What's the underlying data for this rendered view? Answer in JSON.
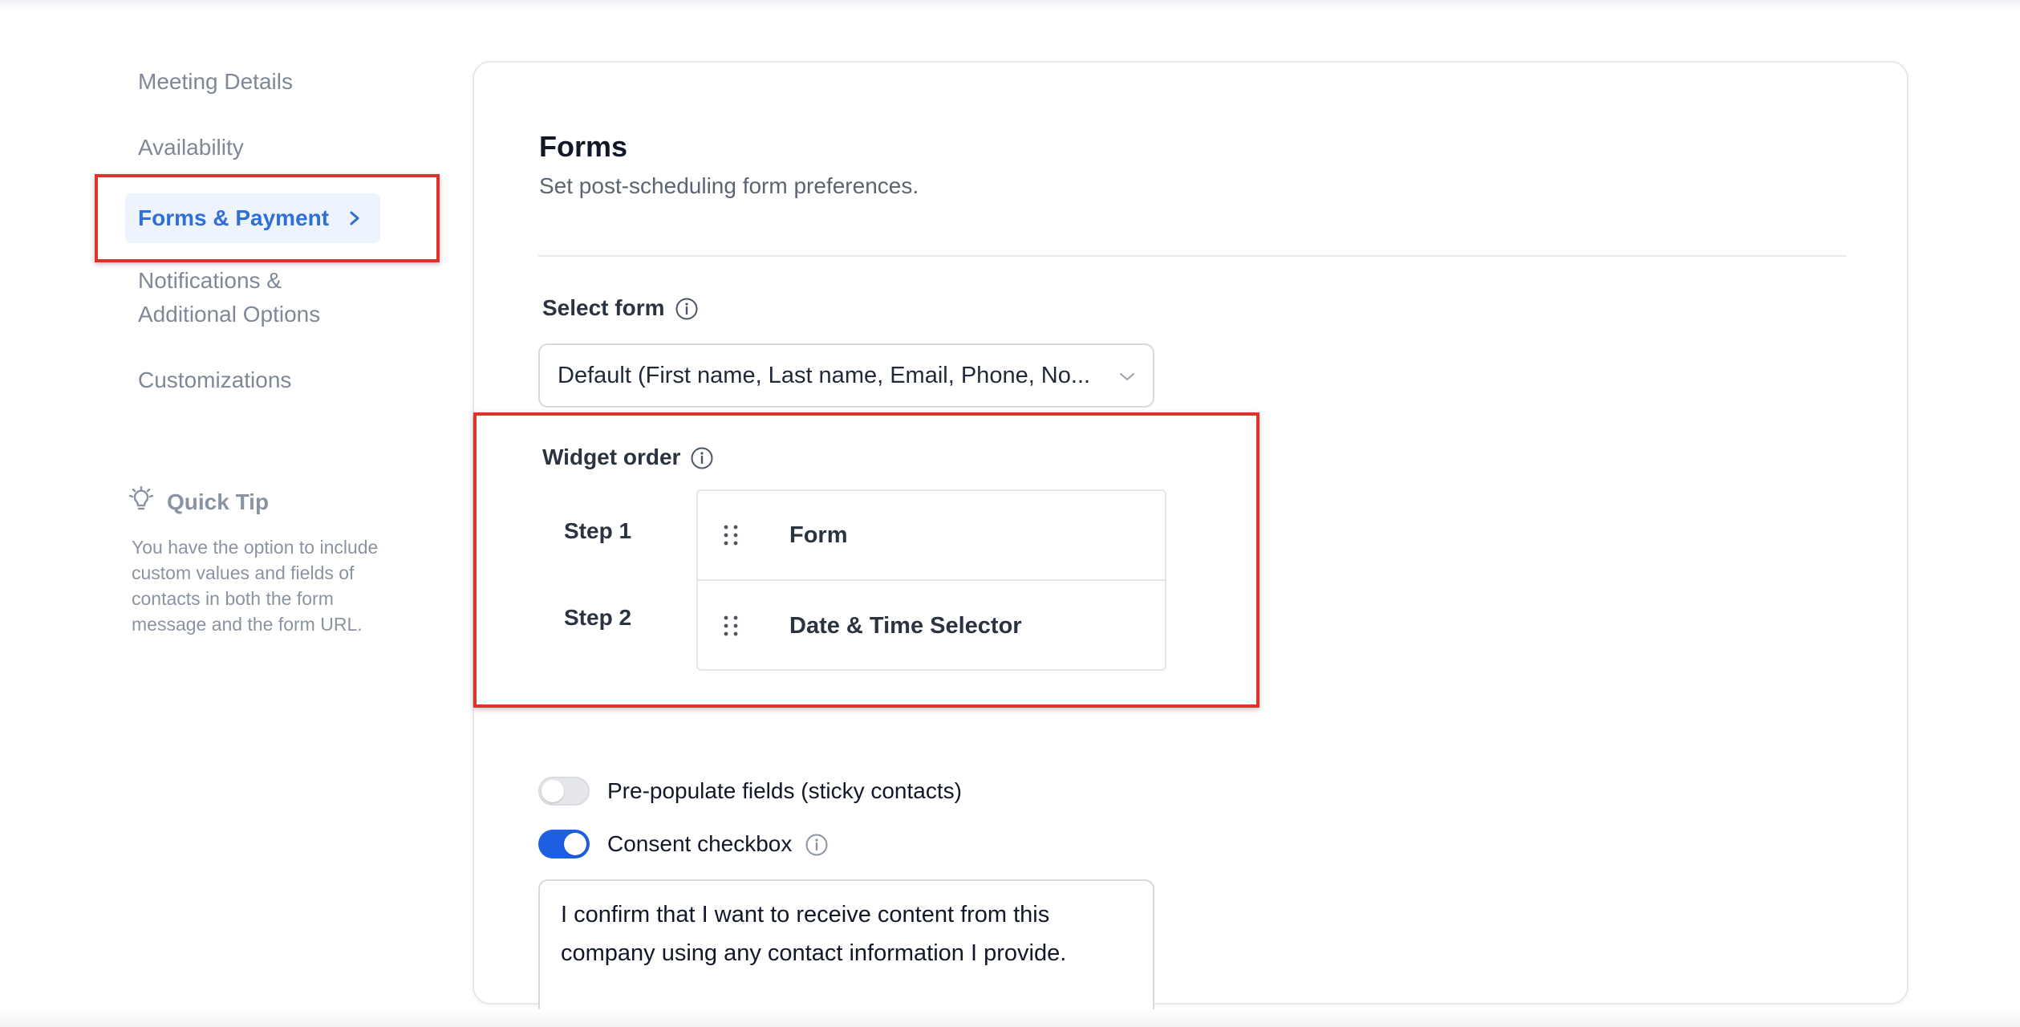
{
  "sidebar": {
    "items": [
      {
        "label": "Meeting Details",
        "active": false
      },
      {
        "label": "Availability",
        "active": false
      },
      {
        "label": "Forms & Payment",
        "active": true
      },
      {
        "label": "Notifications & Additional Options",
        "active": false
      },
      {
        "label": "Customizations",
        "active": false
      }
    ],
    "active_chevron_icon": "chevron-right-icon",
    "quick_tip": {
      "icon": "lightbulb-icon",
      "title": "Quick Tip",
      "text": "You have the option to include custom values and fields of contacts in both the form message and the form URL."
    }
  },
  "main": {
    "title": "Forms",
    "subtitle": "Set post-scheduling form preferences.",
    "select_form": {
      "label": "Select form",
      "value": "Default (First name, Last name, Email, Phone, No..."
    },
    "widget_order": {
      "label": "Widget order",
      "steps": [
        {
          "step": "Step 1",
          "widget": "Form"
        },
        {
          "step": "Step 2",
          "widget": "Date & Time Selector"
        }
      ]
    },
    "prepopulate": {
      "label": "Pre-populate fields (sticky contacts)",
      "enabled": false
    },
    "consent": {
      "label": "Consent checkbox",
      "enabled": true,
      "text": "I confirm that I want to receive content from this company using any contact information I provide."
    }
  },
  "colors": {
    "accent": "#1d5fe0",
    "active_nav_text": "#2f6fd6",
    "active_nav_bg": "#eef4fe",
    "highlight": "#e0322c"
  }
}
